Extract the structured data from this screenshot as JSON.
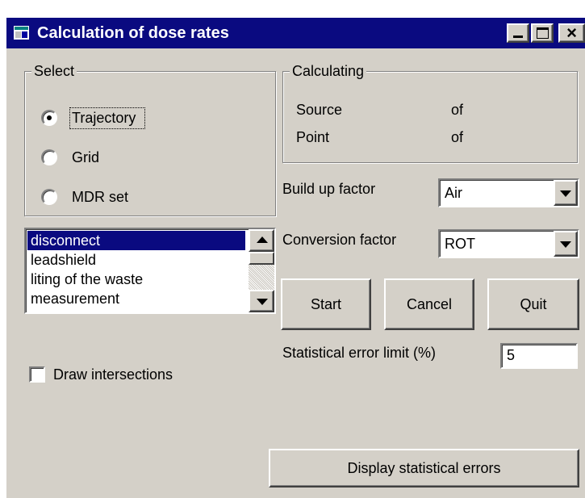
{
  "window": {
    "title": "Calculation of dose rates",
    "close_glyph": "×"
  },
  "select_group": {
    "legend": "Select",
    "options": [
      {
        "label": "Trajectory",
        "checked": true
      },
      {
        "label": "Grid",
        "checked": false
      },
      {
        "label": "MDR set",
        "checked": false
      }
    ]
  },
  "listbox": {
    "items": [
      {
        "label": "disconnect",
        "selected": true
      },
      {
        "label": "leadshield",
        "selected": false
      },
      {
        "label": "liting of the waste",
        "selected": false
      },
      {
        "label": "measurement",
        "selected": false
      }
    ]
  },
  "draw_intersections": {
    "label": "Draw intersections",
    "checked": false
  },
  "calculating_group": {
    "legend": "Calculating",
    "source_label": "Source",
    "source_of": "of",
    "point_label": "Point",
    "point_of": "of"
  },
  "build_up": {
    "label": "Build up factor",
    "value": "Air"
  },
  "conversion": {
    "label": "Conversion factor",
    "value": "ROT"
  },
  "buttons": {
    "start": "Start",
    "cancel": "Cancel",
    "quit": "Quit"
  },
  "error_limit": {
    "label": "Statistical error limit (%)",
    "value": "5"
  },
  "display_errors_button": "Display statistical errors",
  "colors": {
    "titlebar": "#0a0a80",
    "face": "#d4d0c8",
    "selection": "#0a0a80"
  },
  "icons": [
    "app-icon",
    "minimize-icon",
    "maximize-icon",
    "close-icon",
    "scroll-up-icon",
    "scroll-down-icon",
    "dropdown-arrow-icon"
  ]
}
